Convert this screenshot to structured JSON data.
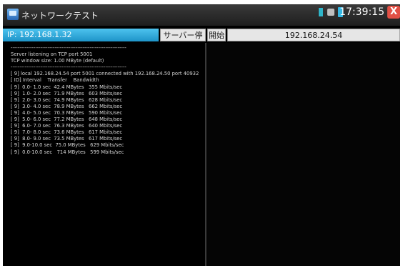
{
  "titlebar": {
    "app_title": "ネットワークテスト",
    "time": "17:39:15",
    "close_label": "X"
  },
  "toolbar": {
    "ip_label": "IP: 192.168.1.32",
    "stop_server_label": "サーバー停止",
    "start_label": "開始",
    "target_ip": "192.168.24.54"
  },
  "log": {
    "lines": [
      "------------------------------------------------------------------",
      "Server listening on TCP port 5001",
      "TCP window size: 1.00 MByte (default)",
      "------------------------------------------------------------------",
      "[ 9] local 192.168.24.54 port 5001 connected with 192.168.24.50 port 40932",
      "[ ID] Interval    Transfer    Bandwidth",
      "[ 9]  0.0- 1.0 sec  42.4 MBytes   355 Mbits/sec",
      "[ 9]  1.0- 2.0 sec  71.9 MBytes   603 Mbits/sec",
      "[ 9]  2.0- 3.0 sec  74.9 MBytes   628 Mbits/sec",
      "[ 9]  3.0- 4.0 sec  78.9 MBytes   662 Mbits/sec",
      "[ 9]  4.0- 5.0 sec  70.3 MBytes   590 Mbits/sec",
      "[ 9]  5.0- 6.0 sec  77.2 MBytes   648 Mbits/sec",
      "[ 9]  6.0- 7.0 sec  76.3 MBytes   640 Mbits/sec",
      "[ 9]  7.0- 8.0 sec  73.6 MBytes   617 Mbits/sec",
      "[ 9]  8.0- 9.0 sec  73.5 MBytes   617 Mbits/sec",
      "[ 9]  9.0-10.0 sec  75.0 MBytes   629 Mbits/sec",
      "[ 9]  0.0-10.0 sec   714 MBytes   599 Mbits/sec"
    ]
  },
  "colors": {
    "ip_box": "#1e94c9",
    "close_button": "#e25045",
    "background": "#000000"
  },
  "icons": [
    "app-icon",
    "signal-icon",
    "plug-icon",
    "battery-icon",
    "close-icon"
  ]
}
